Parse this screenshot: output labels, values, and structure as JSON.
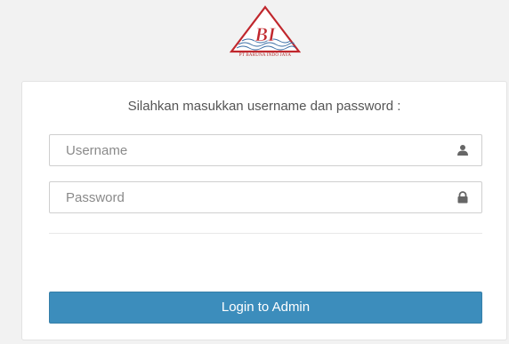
{
  "logo": {
    "letters": "BI",
    "caption": "PT BARUNA INDO JAYA",
    "icon": "company-logo-triangle"
  },
  "login": {
    "prompt": "Silahkan masukkan username dan password :",
    "username_placeholder": "Username",
    "username_icon": "user-icon",
    "password_placeholder": "Password",
    "password_icon": "lock-icon",
    "button_label": "Login to Admin"
  },
  "colors": {
    "background": "#f2f2f2",
    "button": "#3c8dbc",
    "logo_red": "#c0272d"
  }
}
